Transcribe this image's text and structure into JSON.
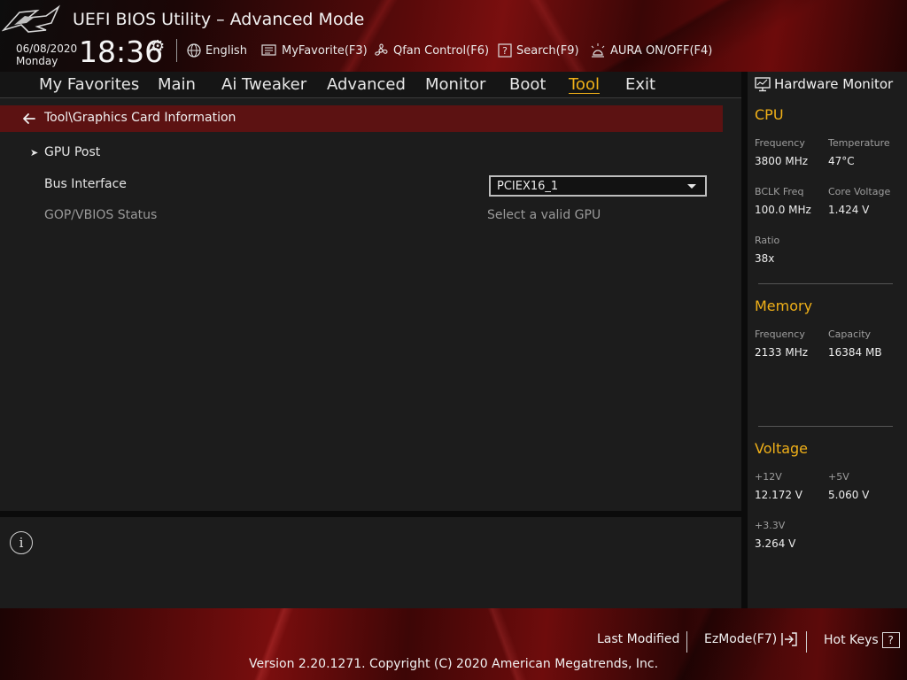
{
  "header": {
    "title": "UEFI BIOS Utility – Advanced Mode",
    "date": "06/08/2020",
    "day": "Monday",
    "time": "18:36",
    "items": {
      "language": "English",
      "favorite": "MyFavorite(F3)",
      "qfan": "Qfan Control(F6)",
      "search": "Search(F9)",
      "aura": "AURA ON/OFF(F4)"
    }
  },
  "menu": {
    "items": [
      "My Favorites",
      "Main",
      "Ai Tweaker",
      "Advanced",
      "Monitor",
      "Boot",
      "Tool",
      "Exit"
    ],
    "active": "Tool"
  },
  "main": {
    "breadcrumb": "Tool\\Graphics Card Information",
    "rows": {
      "gpu_post": "GPU Post",
      "bus_interface_label": "Bus Interface",
      "bus_interface_value": "PCIEX16_1",
      "gop_label": "GOP/VBIOS Status",
      "gop_value": "Select a valid GPU"
    }
  },
  "hw_monitor": {
    "title": "Hardware Monitor",
    "cpu": {
      "title": "CPU",
      "frequency_label": "Frequency",
      "frequency_value": "3800 MHz",
      "temperature_label": "Temperature",
      "temperature_value": "47°C",
      "bclk_label": "BCLK Freq",
      "bclk_value": "100.0 MHz",
      "core_voltage_label": "Core Voltage",
      "core_voltage_value": "1.424 V",
      "ratio_label": "Ratio",
      "ratio_value": "38x"
    },
    "memory": {
      "title": "Memory",
      "frequency_label": "Frequency",
      "frequency_value": "2133 MHz",
      "capacity_label": "Capacity",
      "capacity_value": "16384 MB"
    },
    "voltage": {
      "title": "Voltage",
      "v12_label": "+12V",
      "v12_value": "12.172 V",
      "v5_label": "+5V",
      "v5_value": "5.060 V",
      "v33_label": "+3.3V",
      "v33_value": "3.264 V"
    }
  },
  "footer": {
    "last_modified": "Last Modified",
    "ezmode": "EzMode(F7)",
    "hotkeys": "Hot Keys",
    "hotkeys_icon": "?",
    "copyright": "Version 2.20.1271. Copyright (C) 2020 American Megatrends, Inc."
  },
  "colors": {
    "accent": "#f0b018",
    "breadcrumb_bg": "#5c1212",
    "panel_bg": "#1c1c1c"
  },
  "icons": {
    "settings": "gear-icon",
    "language": "globe-icon",
    "favorite": "favorite-icon",
    "qfan": "fan-icon",
    "search": "search-icon",
    "aura": "aura-icon",
    "back": "back-arrow-icon",
    "info": "info-icon",
    "monitor": "monitor-icon",
    "ezmode": "exit-icon"
  }
}
